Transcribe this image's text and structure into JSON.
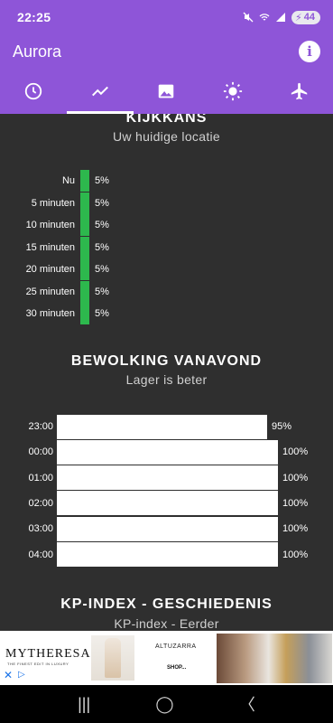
{
  "status": {
    "time": "22:25",
    "battery": "44"
  },
  "app": {
    "title": "Aurora"
  },
  "tabs": [
    {
      "icon": "clock-icon",
      "active": false
    },
    {
      "icon": "trend-icon",
      "active": true
    },
    {
      "icon": "image-icon",
      "active": false
    },
    {
      "icon": "sun-icon",
      "active": false
    },
    {
      "icon": "airplane-icon",
      "active": false
    }
  ],
  "kijkkans": {
    "title": "KIJKKANS",
    "subtitle": "Uw huidige locatie",
    "rows": [
      {
        "label": "Nu",
        "value": "5%"
      },
      {
        "label": "5 minuten",
        "value": "5%"
      },
      {
        "label": "10 minuten",
        "value": "5%"
      },
      {
        "label": "15 minuten",
        "value": "5%"
      },
      {
        "label": "20 minuten",
        "value": "5%"
      },
      {
        "label": "25 minuten",
        "value": "5%"
      },
      {
        "label": "30 minuten",
        "value": "5%"
      }
    ],
    "bar_color": "#2db84d"
  },
  "bewolking": {
    "title": "BEWOLKING VANAVOND",
    "subtitle": "Lager is beter",
    "rows": [
      {
        "label": "23:00",
        "value": "95%",
        "fraction": 0.95
      },
      {
        "label": "00:00",
        "value": "100%",
        "fraction": 1.0
      },
      {
        "label": "01:00",
        "value": "100%",
        "fraction": 1.0
      },
      {
        "label": "02:00",
        "value": "100%",
        "fraction": 1.0
      },
      {
        "label": "03:00",
        "value": "100%",
        "fraction": 1.0
      },
      {
        "label": "04:00",
        "value": "100%",
        "fraction": 1.0
      }
    ]
  },
  "kp": {
    "title": "KP-INDEX - GESCHIEDENIS",
    "subtitle": "KP-index - Eerder"
  },
  "ad": {
    "brand": "MYTHERESA",
    "tagline": "THE FINEST EDIT IN LUXURY",
    "designer": "ALTUZARRA",
    "cta": "SHOP..."
  },
  "colors": {
    "accent": "#8e55d8",
    "background": "#2f2f2f"
  }
}
